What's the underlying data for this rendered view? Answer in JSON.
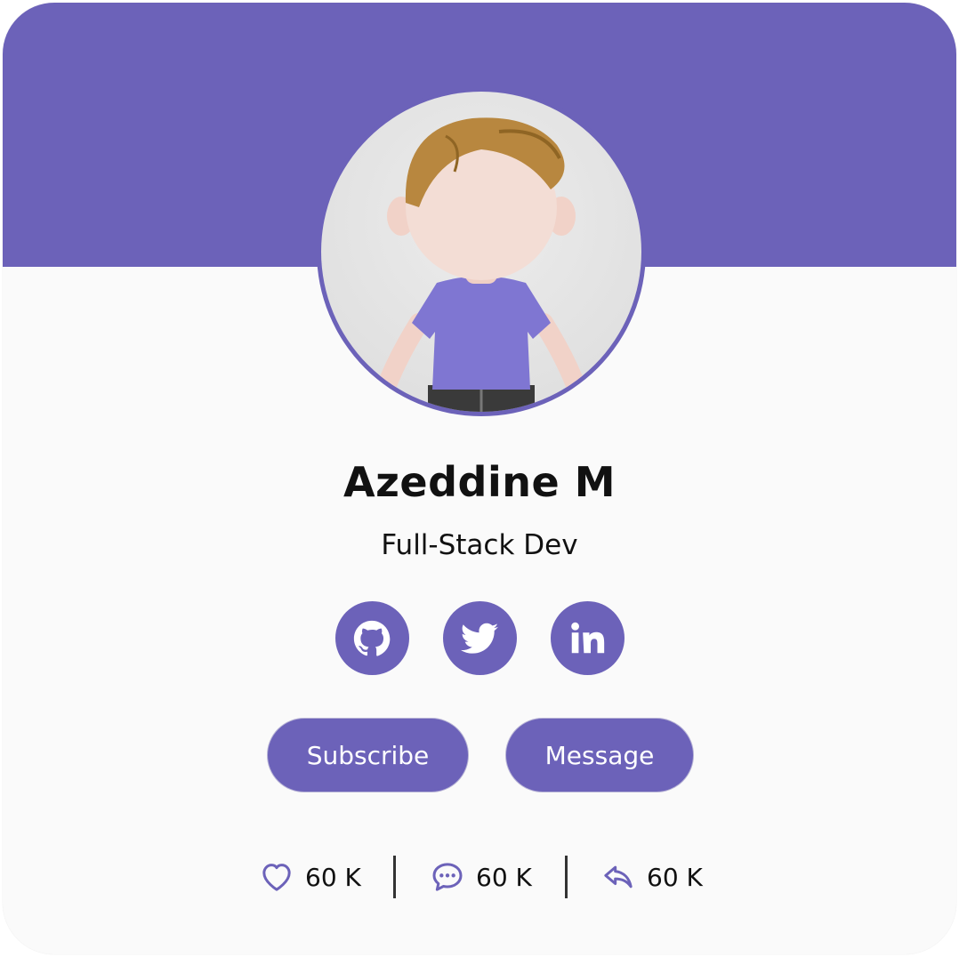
{
  "profile": {
    "name": "Azeddine M",
    "role": "Full-Stack Dev"
  },
  "socials": [
    {
      "icon": "github-icon"
    },
    {
      "icon": "twitter-icon"
    },
    {
      "icon": "linkedin-icon"
    }
  ],
  "buttons": {
    "subscribe_label": "Subscribe",
    "message_label": "Message"
  },
  "stats": {
    "likes": "60 K",
    "comments": "60 K",
    "shares": "60 K"
  },
  "colors": {
    "accent": "#6c62b9",
    "card_background": "#fafafa",
    "text": "#111111"
  }
}
